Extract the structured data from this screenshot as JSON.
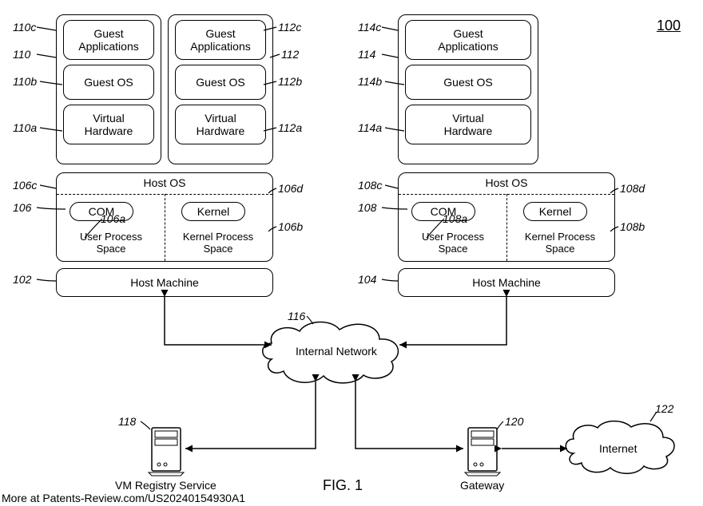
{
  "refTop": "100",
  "figure": "FIG. 1",
  "footer": "More at Patents-Review.com/US20240154930A1",
  "vm": {
    "apps": "Guest\nApplications",
    "os": "Guest OS",
    "hw": "Virtual\nHardware"
  },
  "host": {
    "title": "Host OS",
    "com": "COM",
    "kernel": "Kernel",
    "ups": "User Process\nSpace",
    "kps": "Kernel Process\nSpace"
  },
  "machine": "Host Machine",
  "net": {
    "internal": "Internal Network",
    "internet": "Internet",
    "gateway": "Gateway",
    "registry": "VM Registry Service"
  },
  "refs": {
    "r110c": "110c",
    "r110": "110",
    "r110b": "110b",
    "r110a": "110a",
    "r112c": "112c",
    "r112": "112",
    "r112b": "112b",
    "r112a": "112a",
    "r114c": "114c",
    "r114": "114",
    "r114b": "114b",
    "r114a": "114a",
    "r106c": "106c",
    "r106": "106",
    "r106d": "106d",
    "r106a": "106a",
    "r106b": "106b",
    "r108c": "108c",
    "r108": "108",
    "r108d": "108d",
    "r108a": "108a",
    "r108b": "108b",
    "r102": "102",
    "r104": "104",
    "r116": "116",
    "r118": "118",
    "r120": "120",
    "r122": "122"
  }
}
